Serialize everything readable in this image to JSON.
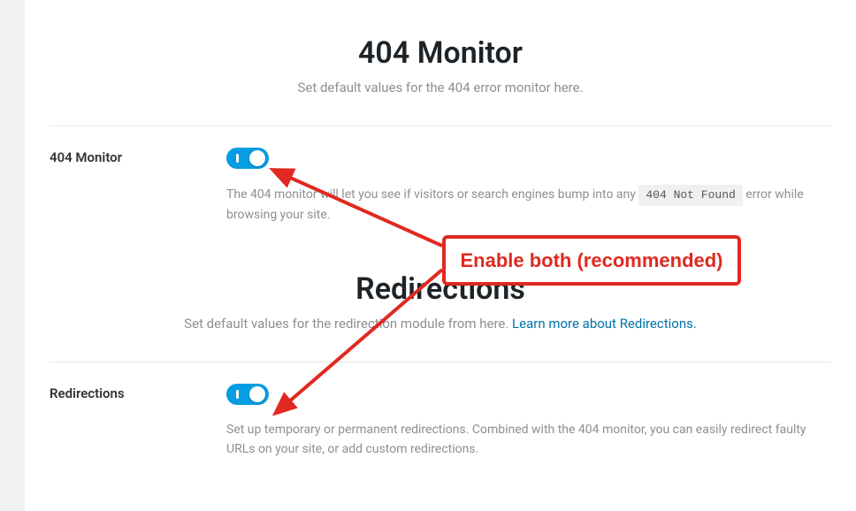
{
  "section404": {
    "title": "404 Monitor",
    "subtitle": "Set default values for the 404 error monitor here.",
    "row": {
      "label": "404 Monitor",
      "toggleOn": true,
      "descPrefix": "The 404 monitor will let you see if visitors or search engines bump into any ",
      "code": "404 Not Found",
      "descSuffix": " error while browsing your site."
    }
  },
  "sectionRedir": {
    "title": "Redirections",
    "subtitlePrefix": "Set default values for the redirection module from here. ",
    "linkText": "Learn more about Redirections.",
    "row": {
      "label": "Redirections",
      "toggleOn": true,
      "desc": "Set up temporary or permanent redirections. Combined with the 404 monitor, you can easily redirect faulty URLs on your site, or add custom redirections."
    }
  },
  "annotation": {
    "label": "Enable both (recommended)",
    "color": "#e02920"
  }
}
